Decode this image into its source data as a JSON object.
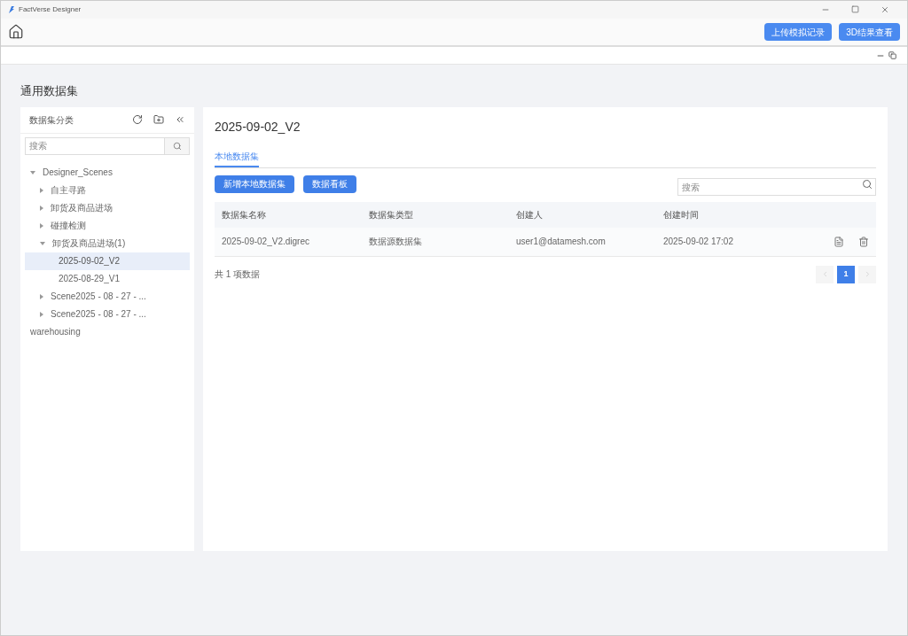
{
  "window": {
    "title": "FactVerse Designer"
  },
  "toolbar": {
    "buttons": [
      "上传模拟记录",
      "3D结果查看"
    ]
  },
  "page_title": "通用数据集",
  "sidebar": {
    "title": "数据集分类",
    "search": {
      "placeholder": "搜索"
    },
    "tree": [
      {
        "label": "Designer_Scenes",
        "kind": "folder",
        "expanded": true,
        "selected": false,
        "children": [
          {
            "label": "自主寻路",
            "kind": "folder",
            "expanded": false,
            "selected": false
          },
          {
            "label": "卸货及商品进场",
            "kind": "folder",
            "expanded": false,
            "selected": false
          },
          {
            "label": "碰撞检测",
            "kind": "folder",
            "expanded": false,
            "selected": false
          },
          {
            "label": "卸货及商品进场(1)",
            "kind": "folder",
            "expanded": true,
            "selected": false,
            "children": [
              {
                "label": "2025-09-02_V2",
                "kind": "leaf",
                "selected": true
              },
              {
                "label": "2025-08-29_V1",
                "kind": "leaf",
                "selected": false
              }
            ]
          },
          {
            "label": "Scene2025 - 08 - 27 - ...",
            "kind": "folder",
            "expanded": false,
            "selected": false
          },
          {
            "label": "Scene2025 - 08 - 27 - ...",
            "kind": "folder",
            "expanded": false,
            "selected": false
          }
        ]
      },
      {
        "label": "warehousing",
        "kind": "leaf",
        "selected": false
      }
    ]
  },
  "main": {
    "title": "2025-09-02_V2",
    "tabs": [
      {
        "label": "本地数据集",
        "selected": true
      }
    ],
    "buttons": [
      "新增本地数据集",
      "数据看板"
    ],
    "search": {
      "placeholder": "搜索"
    },
    "table": {
      "columns": [
        "数据集名称",
        "数据集类型",
        "创建人",
        "创建时间"
      ],
      "rows": [
        {
          "cells": [
            "2025-09-02_V2.digrec",
            "数据源数据集",
            "user1@datamesh.com",
            "2025-09-02 17:02"
          ]
        }
      ]
    },
    "total": "共 1 项数据",
    "pagination": {
      "pages": [
        {
          "label": "1",
          "selected": true
        }
      ]
    }
  }
}
